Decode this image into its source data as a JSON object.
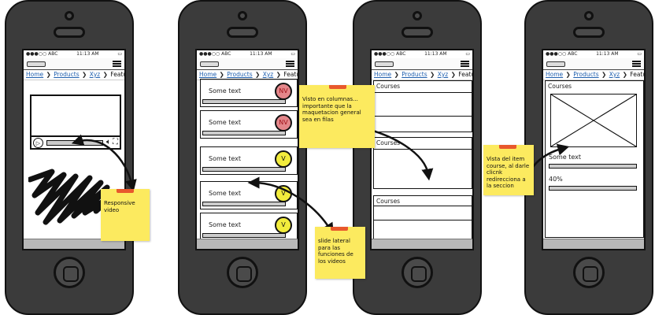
{
  "statusbar": {
    "carrier": "●●●○○ ABC",
    "time": "11:13 AM",
    "battery": "▭"
  },
  "breadcrumb": {
    "home": "Home",
    "products": "Products",
    "xyz": "Xyz",
    "current": "Features",
    "separator": "❯"
  },
  "player": {
    "play_icon": "▷",
    "volume_icon": "🔈︎",
    "fullscreen_icon": "⛶"
  },
  "list_screen": {
    "items": [
      {
        "text": "Some text",
        "badge": "NV"
      },
      {
        "text": "Some text",
        "badge": "NV"
      },
      {
        "text": "Some text",
        "badge": "V"
      },
      {
        "text": "Some text",
        "badge": "V"
      },
      {
        "text": "Some text",
        "badge": "V"
      }
    ]
  },
  "courses_screen": {
    "cards": [
      "Courses",
      "Courses",
      "Courses"
    ]
  },
  "detail_screen": {
    "title": "Courses",
    "text": "Some text",
    "percent": "40%"
  },
  "notes": {
    "responsive": "Responsive video",
    "columns": "Visto en columnas... importante que la maquetacion general sea en filas",
    "item": "Vista del item course, al darle clicnk redirecciona a la seccion",
    "slide": "slide lateral para las funciones de los videos"
  },
  "colors": {
    "phone": "#3b3b3b",
    "note": "#fcea5f",
    "tape": "#e8582c",
    "link": "#1f5fae",
    "badge_nv": "#e4868a",
    "badge_v": "#f2ec3c"
  }
}
